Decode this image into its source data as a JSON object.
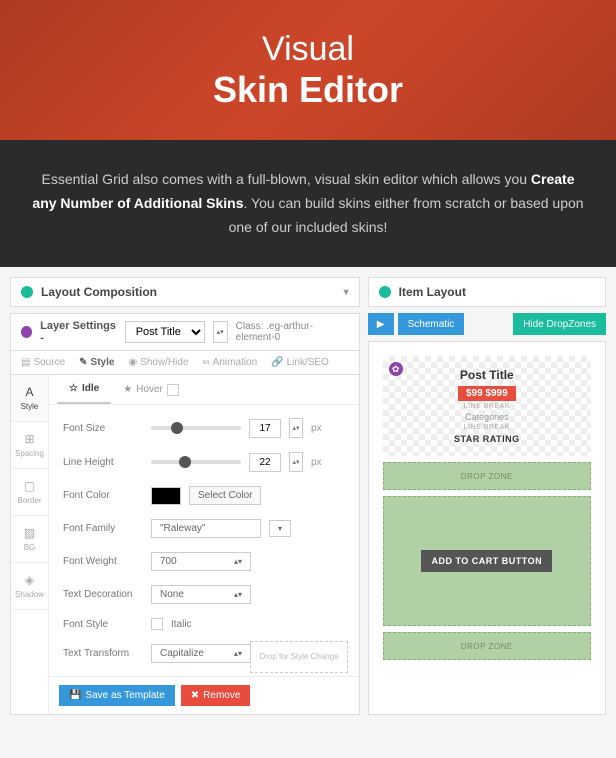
{
  "hero": {
    "title_thin": "Visual",
    "title_bold": "Skin Editor"
  },
  "intro": {
    "pre": "Essential Grid also comes with a full-blown, visual skin editor which allows you ",
    "strong": "Create any Number of Additional Skins",
    "post": ". You can build skins either from scratch or based upon one of our included skins!"
  },
  "left": {
    "composition_title": "Layout Composition",
    "layer_label": "Layer Settings -",
    "layer_select": "Post Title",
    "class_label": "Class:",
    "class_value": ".eg-arthur-element-0",
    "tabs": {
      "source": "Source",
      "style": "Style",
      "showhide": "Show/Hide",
      "animation": "Animation",
      "linkseo": "Link/SEO"
    },
    "side": {
      "style": "Style",
      "spacing": "Spacing",
      "border": "Border",
      "bg": "BG",
      "shadow": "Shadow"
    },
    "sub": {
      "idle": "Idle",
      "hover": "Hover"
    },
    "rows": {
      "font_size": {
        "label": "Font Size",
        "value": "17",
        "unit": "px"
      },
      "line_height": {
        "label": "Line Height",
        "value": "22",
        "unit": "px"
      },
      "font_color": {
        "label": "Font Color",
        "btn": "Select Color"
      },
      "font_family": {
        "label": "Font Family",
        "value": "\"Raleway\""
      },
      "font_weight": {
        "label": "Font Weight",
        "value": "700"
      },
      "text_decoration": {
        "label": "Text Decoration",
        "value": "None"
      },
      "font_style": {
        "label": "Font Style",
        "value": "Italic"
      },
      "text_transform": {
        "label": "Text Transform",
        "value": "Capitalize"
      }
    },
    "drop_hint": "Drop for Style Change",
    "save_btn": "Save as Template",
    "remove_btn": "Remove"
  },
  "right": {
    "title": "Item Layout",
    "schematic": "Schematic",
    "hide": "Hide DropZones",
    "post_title": "Post Title",
    "price": "$99 $999",
    "line_break": "LINE BREAK",
    "categories": "Categories",
    "star_rating": "STAR RATING",
    "drop_zone": "DROP ZONE",
    "add_cart": "ADD TO CART BUTTON"
  }
}
